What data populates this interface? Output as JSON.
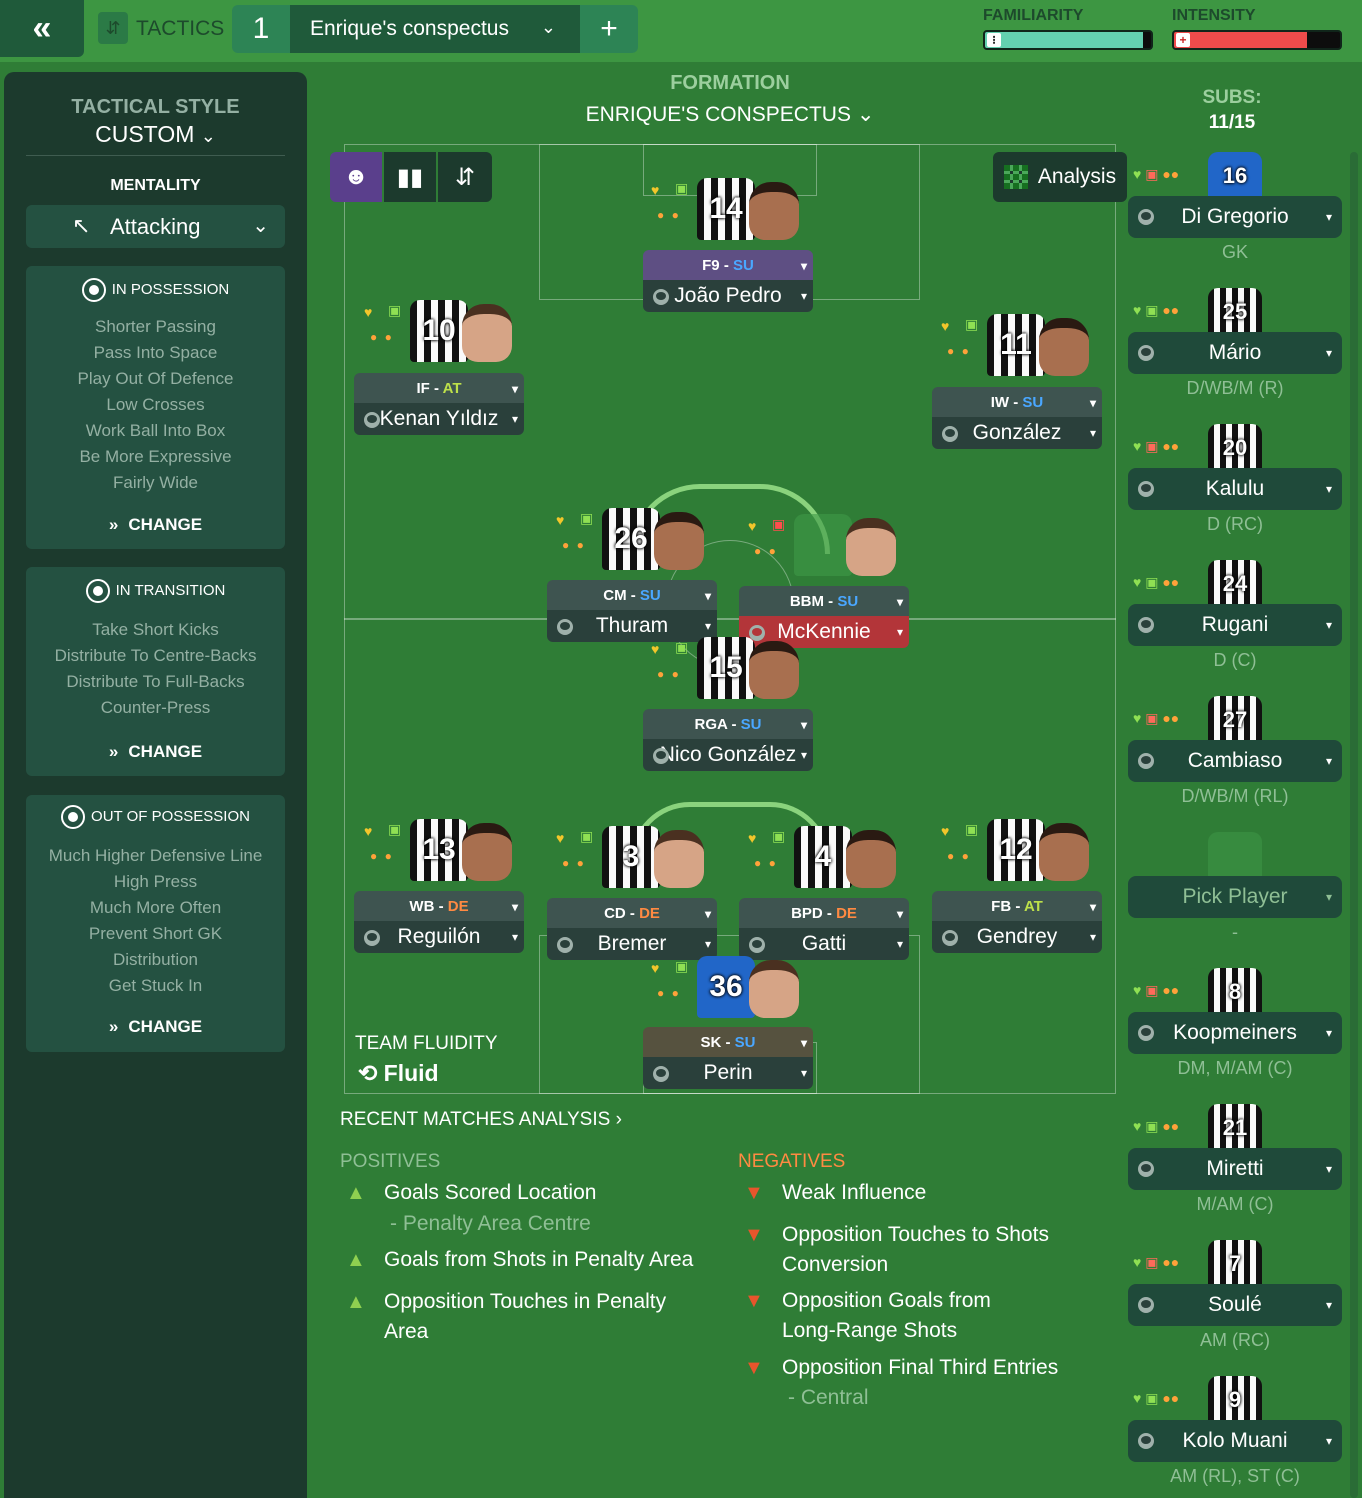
{
  "topbar": {
    "back": "«",
    "tactics_label": "TACTICS",
    "tactic_slot": "1",
    "tactic_name": "Enrique's conspectus",
    "add": "+",
    "familiarity_label": "FAMILIARITY",
    "intensity_label": "INTENSITY",
    "familiarity_level": 0.95,
    "intensity_level": 0.8
  },
  "left": {
    "tactical_style_label": "TACTICAL STYLE",
    "tactical_style_value": "CUSTOM",
    "mentality_label": "MENTALITY",
    "mentality_value": "Attacking",
    "in_possession": {
      "title": "IN POSSESSION",
      "items": [
        "Shorter Passing",
        "Pass Into Space",
        "Play Out Of Defence",
        "Low Crosses",
        "Work Ball Into Box",
        "Be More Expressive",
        "Fairly Wide"
      ],
      "change": "CHANGE"
    },
    "in_transition": {
      "title": "IN TRANSITION",
      "items": [
        "Take Short Kicks",
        "Distribute To Centre-Backs",
        "Distribute To Full-Backs",
        "Counter-Press"
      ],
      "change": "CHANGE"
    },
    "out_of_possession": {
      "title": "OUT OF POSSESSION",
      "items": [
        "Much Higher Defensive Line",
        "High Press",
        "Much More Often",
        "Prevent Short GK",
        "Distribution",
        "Get Stuck In"
      ],
      "change": "CHANGE"
    }
  },
  "formation": {
    "label": "FORMATION",
    "name": "ENRIQUE'S CONSPECTUS"
  },
  "subs_header": {
    "label": "SUBS:",
    "count": "11/15"
  },
  "analysis_button": "Analysis",
  "team_fluidity": {
    "label": "TEAM FLUIDITY",
    "value": "Fluid"
  },
  "players": [
    {
      "num": "14",
      "role": "F9",
      "duty": "SU",
      "name": "João Pedro"
    },
    {
      "num": "10",
      "role": "IF",
      "duty": "AT",
      "name": "Kenan Yıldız"
    },
    {
      "num": "11",
      "role": "IW",
      "duty": "SU",
      "name": "González"
    },
    {
      "num": "26",
      "role": "CM",
      "duty": "SU",
      "name": "Thuram"
    },
    {
      "num": "",
      "role": "BBM",
      "duty": "SU",
      "name": "McKennie"
    },
    {
      "num": "15",
      "role": "RGA",
      "duty": "SU",
      "name": "Nico González"
    },
    {
      "num": "13",
      "role": "WB",
      "duty": "DE",
      "name": "Reguilón"
    },
    {
      "num": "3",
      "role": "CD",
      "duty": "DE",
      "name": "Bremer"
    },
    {
      "num": "4",
      "role": "BPD",
      "duty": "DE",
      "name": "Gatti"
    },
    {
      "num": "12",
      "role": "FB",
      "duty": "AT",
      "name": "Gendrey"
    },
    {
      "num": "36",
      "role": "SK",
      "duty": "SU",
      "name": "Perin"
    }
  ],
  "subs": [
    {
      "num": "16",
      "name": "Di Gregorio",
      "pos": "GK"
    },
    {
      "num": "25",
      "name": "Mário",
      "pos": "D/WB/M (R)"
    },
    {
      "num": "20",
      "name": "Kalulu",
      "pos": "D (RC)"
    },
    {
      "num": "24",
      "name": "Rugani",
      "pos": "D (C)"
    },
    {
      "num": "27",
      "name": "Cambiaso",
      "pos": "D/WB/M (RL)"
    },
    {
      "num": "",
      "name": "Pick Player",
      "pos": "-"
    },
    {
      "num": "8",
      "name": "Koopmeiners",
      "pos": "DM, M/AM (C)"
    },
    {
      "num": "21",
      "name": "Miretti",
      "pos": "M/AM (C)"
    },
    {
      "num": "7",
      "name": "Soulé",
      "pos": "AM (RC)"
    },
    {
      "num": "9",
      "name": "Kolo Muani",
      "pos": "AM (RL), ST (C)"
    }
  ],
  "recent": {
    "title": "RECENT MATCHES ANALYSIS",
    "positives_label": "POSITIVES",
    "negatives_label": "NEGATIVES",
    "positives": [
      "Goals Scored Location",
      "- Penalty Area Centre",
      "Goals from Shots in Penalty Area",
      "Opposition Touches in Penalty",
      "Area"
    ],
    "negatives": [
      "Weak Influence",
      "Opposition Touches to Shots",
      "Conversion",
      "Opposition Goals from",
      "Long-Range Shots",
      "Opposition Final Third Entries",
      "- Central"
    ]
  },
  "colors": {
    "pitch": "#2f7d36",
    "panel": "#1c3a2d",
    "familiarity": "#64d0b0",
    "intensity": "#ef4b4b"
  }
}
